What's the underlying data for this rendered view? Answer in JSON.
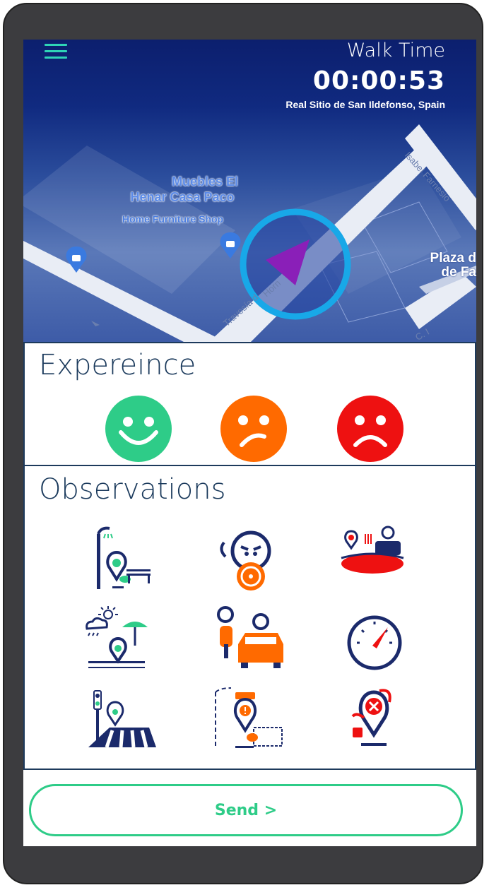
{
  "header": {
    "menu_icon": "hamburger-menu-icon",
    "walk_time_label": "Walk Time",
    "walk_time_value": "00:00:53",
    "location": "Real Sitio de San Ildefonso, Spain"
  },
  "map": {
    "poi_name": "Muebles El Henar Casa Paco",
    "poi_name_line1": "Muebles El",
    "poi_name_line2": "Henar Casa Paco",
    "poi_type": "Home Furniture Shop",
    "street_1": "Travesía d",
    "street_2": "Horn",
    "street_3": "Isabel Farnesio",
    "street_4": "C. I",
    "place_line1": "Plaza d",
    "place_line2": "de Fa",
    "current_position_icon": "navigation-arrow-icon",
    "accent_color": "#18a8e8"
  },
  "experience": {
    "title": "Expereince",
    "faces": [
      {
        "name": "happy",
        "color": "#2ecc88"
      },
      {
        "name": "neutral",
        "color": "#ff6a00"
      },
      {
        "name": "sad",
        "color": "#ee1111"
      }
    ]
  },
  "observations": {
    "title": "Observations",
    "icons": [
      "streetlight-bench-icon",
      "aggressive-driver-icon",
      "vehicle-obstacle-icon",
      "weather-shelter-icon",
      "motorcycle-car-icon",
      "speed-gauge-icon",
      "crosswalk-signal-icon",
      "construction-warning-icon",
      "assault-danger-icon"
    ]
  },
  "send": {
    "label": "Send >",
    "color": "#2ecc88"
  }
}
